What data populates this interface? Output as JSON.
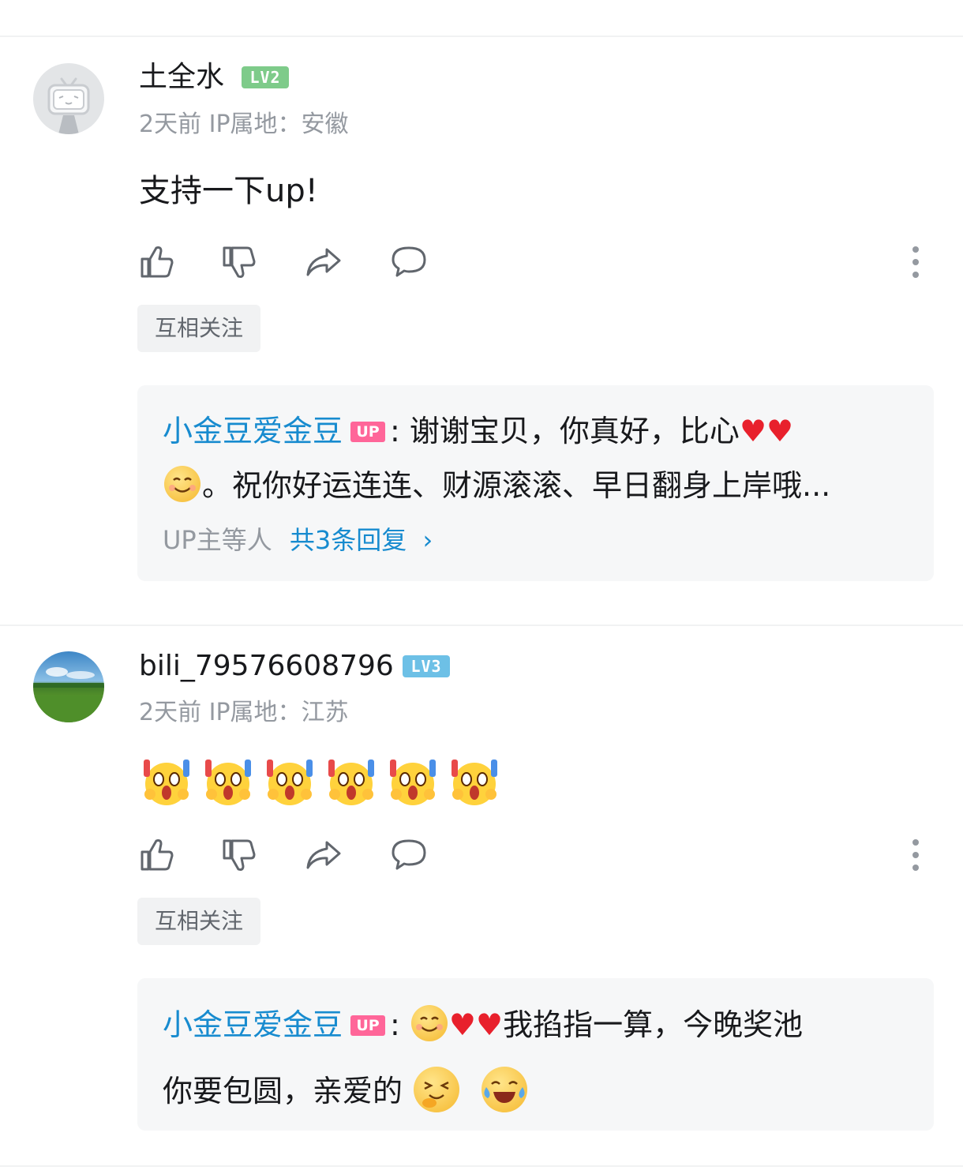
{
  "comments": [
    {
      "username": "土全水",
      "level": "LV2",
      "meta": "2天前 IP属地：安徽",
      "content": "支持一下up!",
      "tag": "互相关注",
      "reply": {
        "author": "小金豆爱金豆",
        "badge": "UP",
        "colon": ":",
        "line1_text": "谢谢宝贝，你真好，比心",
        "line2_text": "。祝你好运连连、财源滚滚、早日翻身上岸哦...",
        "footer_prefix": "UP主等人",
        "footer_link": "共3条回复",
        "footer_chevron": "›"
      }
    },
    {
      "username": "bili_79576608796",
      "level": "LV3",
      "meta": "2天前 IP属地：江苏",
      "emoji_count": 6,
      "tag": "互相关注",
      "reply": {
        "author": "小金豆爱金豆",
        "badge": "UP",
        "colon": ":",
        "line1_text": "我掐指一算，今晚奖池",
        "line2_text": "你要包圆，亲爱的"
      }
    }
  ],
  "colors": {
    "level2": "#7ecb8a",
    "level3": "#6dc0e6",
    "accent_blue": "#178bcf",
    "up_pink": "#ff6699"
  },
  "icons": [
    "like-icon",
    "dislike-icon",
    "share-icon",
    "reply-icon",
    "more-icon"
  ]
}
